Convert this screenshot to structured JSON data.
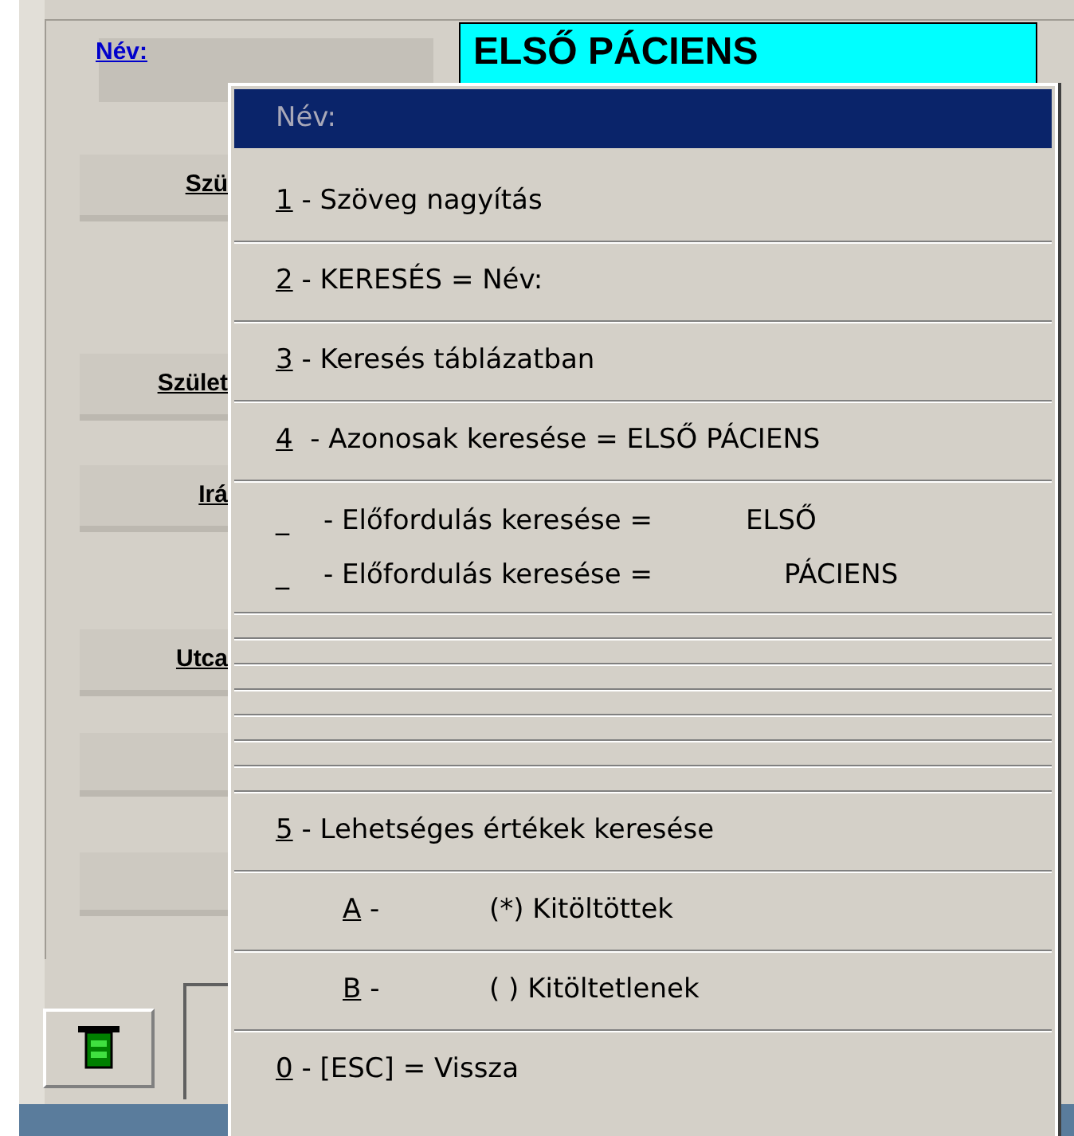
{
  "form": {
    "name_link": "Név:",
    "name_value": "ELSŐ PÁCIENS",
    "labels": [
      {
        "text": "Szü"
      },
      {
        "text": "Szület"
      },
      {
        "text": "Irá"
      },
      {
        "text": "Utca"
      }
    ]
  },
  "menu": {
    "title": "Név:",
    "items": [
      {
        "kind": "item",
        "key": "1",
        "text": " - Szöveg nagyítás"
      },
      {
        "kind": "item",
        "key": "2",
        "text": " - KERESÉS = Név:"
      },
      {
        "kind": "item",
        "key": "3",
        "text": " - Keresés táblázatban"
      },
      {
        "kind": "item",
        "key": "4",
        "text": "  - Azonosak keresése = ELSŐ PÁCIENS"
      },
      {
        "kind": "double",
        "lines": [
          {
            "key": "_",
            "text": "- Előfordulás keresése =",
            "value": "ELSŐ"
          },
          {
            "key": "_",
            "text": "- Előfordulás keresése =",
            "value": "PÁCIENS"
          }
        ]
      },
      {
        "kind": "blank"
      },
      {
        "kind": "blank"
      },
      {
        "kind": "blank"
      },
      {
        "kind": "blank"
      },
      {
        "kind": "blank"
      },
      {
        "kind": "blank"
      },
      {
        "kind": "blank"
      },
      {
        "kind": "item",
        "key": "5",
        "text": " - Lehetséges értékek keresése"
      },
      {
        "kind": "sub",
        "key": "A",
        "text": " -",
        "value": "(*) Kitöltöttek"
      },
      {
        "kind": "sub",
        "key": "B",
        "text": " -",
        "value": "( ) Kitöltetlenek"
      },
      {
        "kind": "item",
        "key": "0",
        "text": " - [ESC] = Vissza"
      }
    ]
  }
}
